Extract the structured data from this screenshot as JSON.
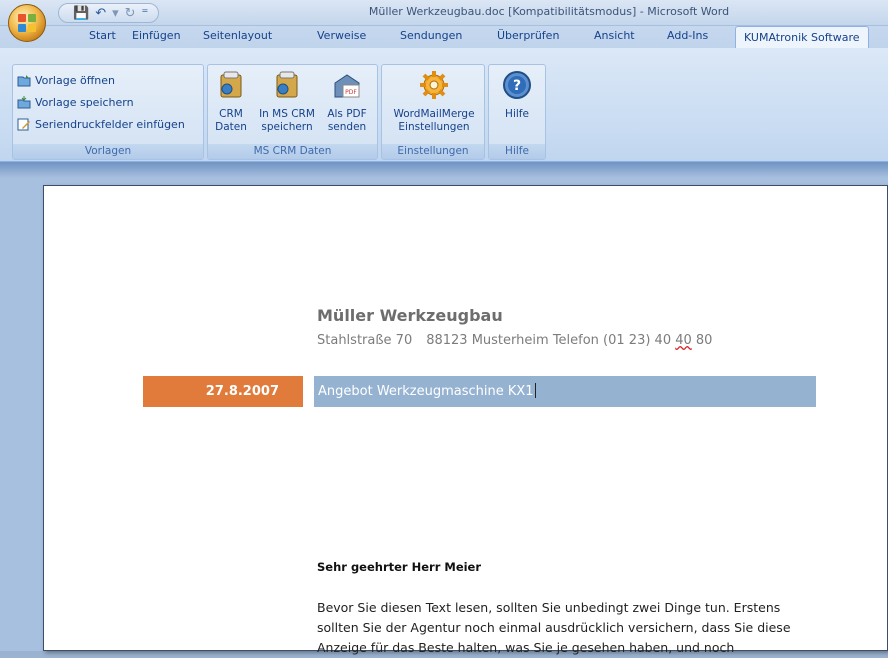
{
  "window": {
    "title": "Müller Werkzeugbau.doc [Kompatibilitätsmodus] - Microsoft Word"
  },
  "qat": {
    "save": "💾",
    "undo": "↶",
    "undo_menu": "▾",
    "redo": "↻",
    "customize": "⁼"
  },
  "tabs": [
    "Start",
    "Einfügen",
    "Seitenlayout",
    "Verweise",
    "Sendungen",
    "Überprüfen",
    "Ansicht",
    "Add-Ins",
    "KUMAtronik Software"
  ],
  "ribbon": {
    "vorlagen": {
      "label": "Vorlagen",
      "items": [
        "Vorlage öffnen",
        "Vorlage speichern",
        "Seriendruckfelder einfügen"
      ]
    },
    "mscrm": {
      "label": "MS CRM Daten",
      "buttons": [
        {
          "line1": "CRM",
          "line2": "Daten"
        },
        {
          "line1": "In MS CRM",
          "line2": "speichern"
        },
        {
          "line1": "Als PDF",
          "line2": "senden"
        }
      ]
    },
    "einstellungen": {
      "label": "Einstellungen",
      "line1": "WordMailMerge",
      "line2": "Einstellungen"
    },
    "hilfe": {
      "label": "Hilfe",
      "button": "Hilfe"
    }
  },
  "pdf_badge": "PDF",
  "document": {
    "company": "Müller Werkzeugbau",
    "address": {
      "street": "Stahlstraße 70",
      "city": "88123 Musterheim",
      "phone_prefix": "Telefon (01 23) 40 ",
      "phone_squig": "40",
      "phone_suffix": " 80"
    },
    "date": "27.8.2007",
    "subject": "Angebot Werkzeugmaschine KX1",
    "greeting": "Sehr geehrter Herr Meier",
    "body": "Bevor Sie diesen Text lesen, sollten Sie unbedingt zwei Dinge tun. Erstens sollten Sie der Agentur noch einmal ausdrücklich versichern, dass Sie diese Anzeige für das Beste halten, was Sie je gesehen haben, und noch"
  },
  "colors": {
    "date_bar": "#e07b3c",
    "subject_bar": "#95b3d1",
    "ribbon_text": "#15428b"
  }
}
